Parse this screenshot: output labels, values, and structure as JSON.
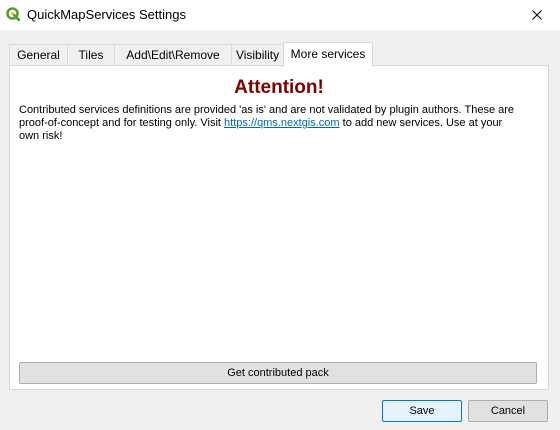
{
  "window": {
    "title": "QuickMapServices Settings"
  },
  "tabs": [
    {
      "label": "General"
    },
    {
      "label": "Tiles"
    },
    {
      "label": "Add\\Edit\\Remove"
    },
    {
      "label": "Visibility"
    },
    {
      "label": "More services",
      "active": true
    }
  ],
  "panel": {
    "heading": "Attention!",
    "notice_before": "Contributed services definitions are provided 'as is' and are not validated by plugin authors. These are proof-of-concept and for testing only. Visit ",
    "link_text": "https://qms.nextgis.com",
    "notice_after": " to add new services. Use at your own risk!",
    "contrib_button": "Get contributed pack"
  },
  "footer": {
    "save_label": "Save",
    "cancel_label": "Cancel"
  },
  "colors": {
    "heading": "#800000",
    "link": "#0068b8",
    "app_icon": "#5a9e2f"
  },
  "icons": {
    "app": "qgis-icon",
    "close": "close-icon"
  }
}
